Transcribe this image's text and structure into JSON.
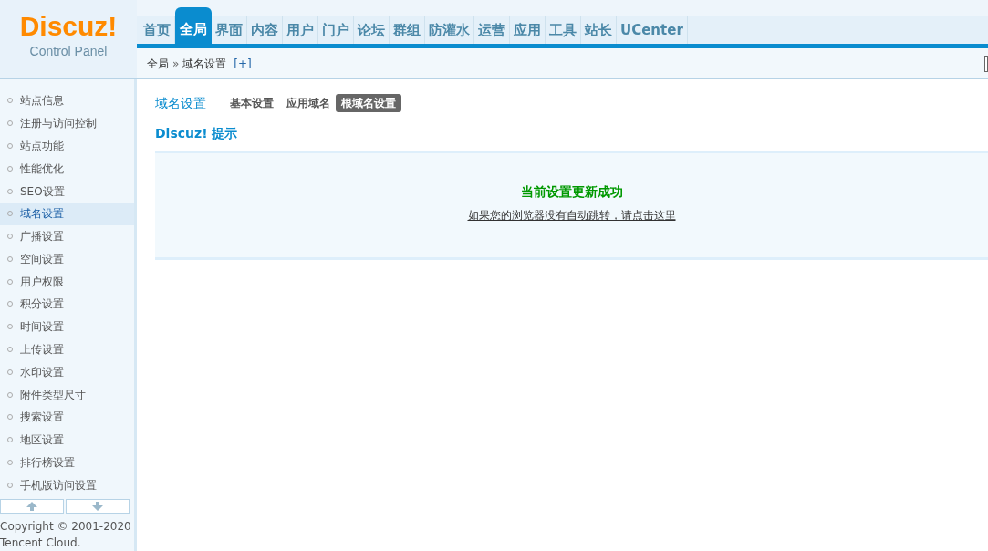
{
  "logo": {
    "name": "Discuz!",
    "subtitle": "Control Panel"
  },
  "nav": [
    {
      "label": "首页",
      "selected": false
    },
    {
      "label": "全局",
      "selected": true
    },
    {
      "label": "界面",
      "selected": false
    },
    {
      "label": "内容",
      "selected": false
    },
    {
      "label": "用户",
      "selected": false
    },
    {
      "label": "门户",
      "selected": false
    },
    {
      "label": "论坛",
      "selected": false
    },
    {
      "label": "群组",
      "selected": false
    },
    {
      "label": "防灌水",
      "selected": false
    },
    {
      "label": "运营",
      "selected": false
    },
    {
      "label": "应用",
      "selected": false
    },
    {
      "label": "工具",
      "selected": false
    },
    {
      "label": "站长",
      "selected": false
    },
    {
      "label": "UCenter",
      "selected": false
    }
  ],
  "breadcrumb": {
    "parent": "全局",
    "separator": "»",
    "current": "域名设置",
    "add": "[+]"
  },
  "sidebar": {
    "items": [
      {
        "label": "站点信息",
        "selected": false
      },
      {
        "label": "注册与访问控制",
        "selected": false
      },
      {
        "label": "站点功能",
        "selected": false
      },
      {
        "label": "性能优化",
        "selected": false
      },
      {
        "label": "SEO设置",
        "selected": false
      },
      {
        "label": "域名设置",
        "selected": true
      },
      {
        "label": "广播设置",
        "selected": false
      },
      {
        "label": "空间设置",
        "selected": false
      },
      {
        "label": "用户权限",
        "selected": false
      },
      {
        "label": "积分设置",
        "selected": false
      },
      {
        "label": "时间设置",
        "selected": false
      },
      {
        "label": "上传设置",
        "selected": false
      },
      {
        "label": "水印设置",
        "selected": false
      },
      {
        "label": "附件类型尺寸",
        "selected": false
      },
      {
        "label": "搜索设置",
        "selected": false
      },
      {
        "label": "地区设置",
        "selected": false
      },
      {
        "label": "排行榜设置",
        "selected": false
      },
      {
        "label": "手机版访问设置",
        "selected": false
      }
    ],
    "copyright": [
      "Copyright © 2001-2020",
      "Tencent Cloud."
    ]
  },
  "page": {
    "title": "域名设置",
    "tabs": [
      {
        "label": "基本设置",
        "selected": false
      },
      {
        "label": "应用域名",
        "selected": false
      },
      {
        "label": "根域名设置",
        "selected": true
      }
    ],
    "tip_title": "Discuz! 提示",
    "message": "当前设置更新成功",
    "redirect_link": "如果您的浏览器没有自动跳转，请点击这里"
  }
}
